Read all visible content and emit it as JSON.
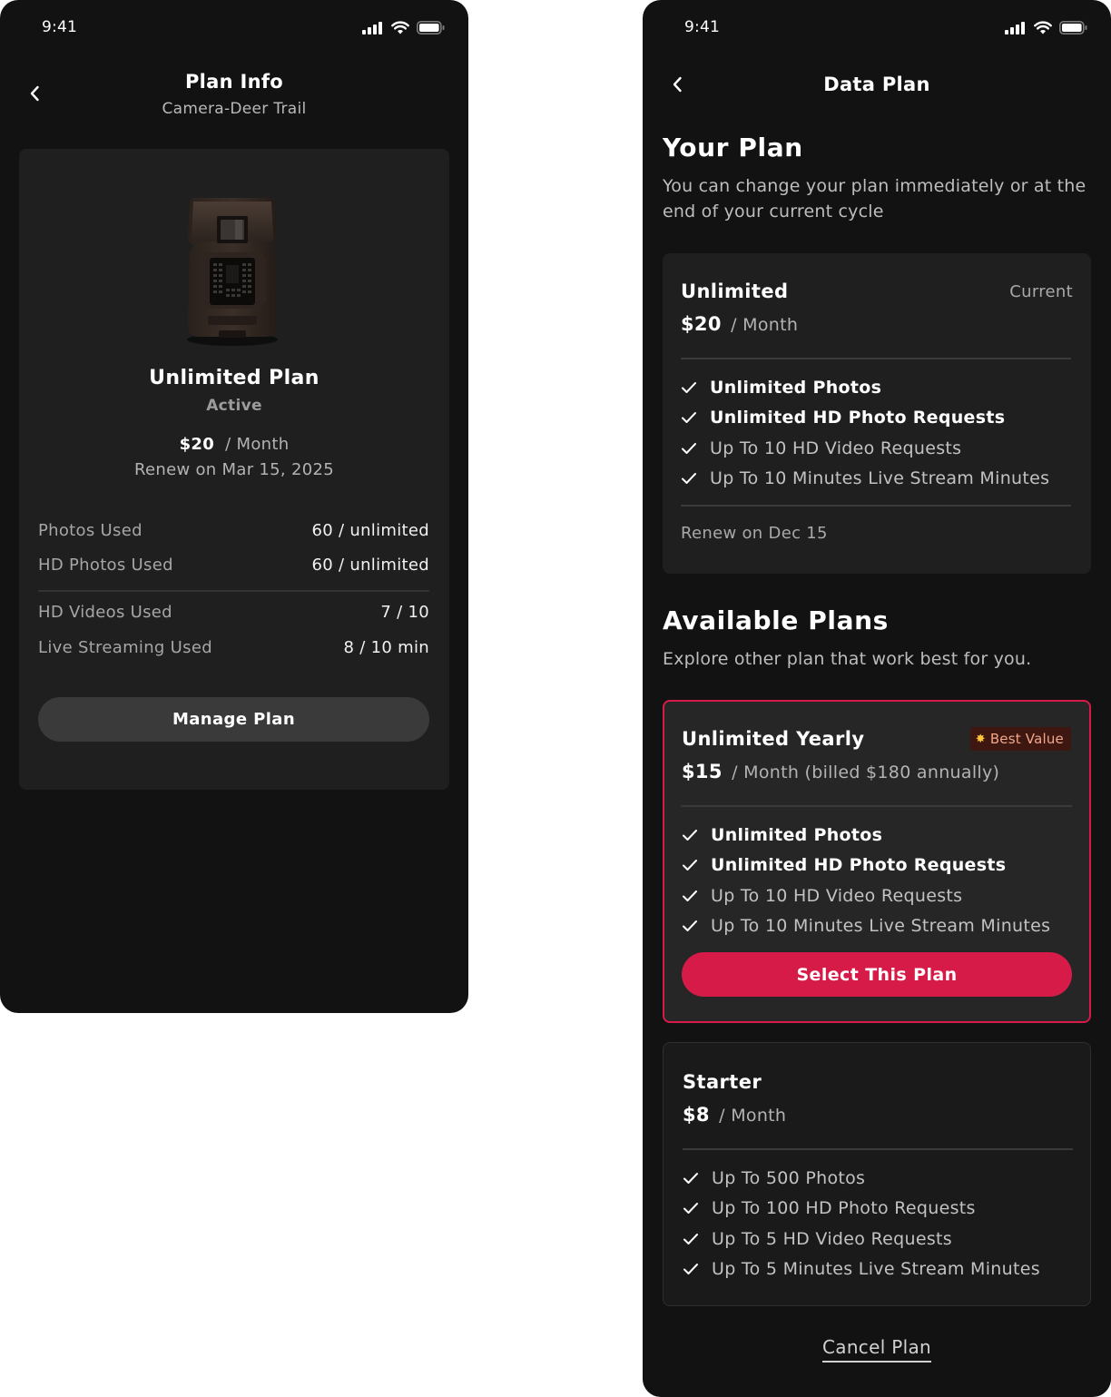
{
  "colors": {
    "background": "#121212",
    "card": "#1f1f1f",
    "accent": "#d61b48",
    "badge_bg": "#3d1710",
    "badge_text": "#f1a78c"
  },
  "plan_info_screen": {
    "status_time": "9:41",
    "title": "Plan Info",
    "subtitle": "Camera-Deer Trail",
    "plan_name": "Unlimited Plan",
    "plan_status": "Active",
    "price": "$20",
    "period": "/ Month",
    "renew": "Renew on Mar 15, 2025",
    "usage": [
      {
        "label": "Photos Used",
        "value": "60 / unlimited"
      },
      {
        "label": "HD Photos Used",
        "value": "60 / unlimited"
      },
      {
        "label": "HD Videos Used",
        "value": "7 / 10"
      },
      {
        "label": "Live Streaming Used",
        "value": "8 / 10 min"
      }
    ],
    "manage_button": "Manage Plan"
  },
  "data_plan_screen": {
    "status_time": "9:41",
    "title": "Data Plan",
    "your_plan_title": "Your Plan",
    "your_plan_subtitle": "You can change your plan immediately or at the end of your current cycle",
    "current_plan": {
      "name": "Unlimited",
      "tag": "Current",
      "price": "$20",
      "period": "/ Month",
      "features": [
        "Unlimited Photos",
        "Unlimited HD Photo Requests",
        "Up To 10 HD Video Requests",
        "Up To 10 Minutes Live Stream Minutes"
      ],
      "renew": "Renew on Dec 15"
    },
    "available_title": "Available Plans",
    "available_subtitle": "Explore other plan that work best for you.",
    "yearly_plan": {
      "name": "Unlimited Yearly",
      "badge": "Best Value",
      "price": "$15",
      "period": "/ Month (billed $180 annually)",
      "features": [
        "Unlimited Photos",
        "Unlimited HD Photo Requests",
        "Up To 10 HD Video Requests",
        "Up To 10 Minutes Live Stream Minutes"
      ],
      "select_button": "Select This Plan"
    },
    "starter_plan": {
      "name": "Starter",
      "price": "$8",
      "period": "/ Month",
      "features": [
        "Up To 500 Photos",
        "Up To 100 HD Photo Requests",
        "Up To 5 HD Video Requests",
        "Up To 5 Minutes Live Stream Minutes"
      ]
    },
    "cancel_link": "Cancel Plan"
  }
}
